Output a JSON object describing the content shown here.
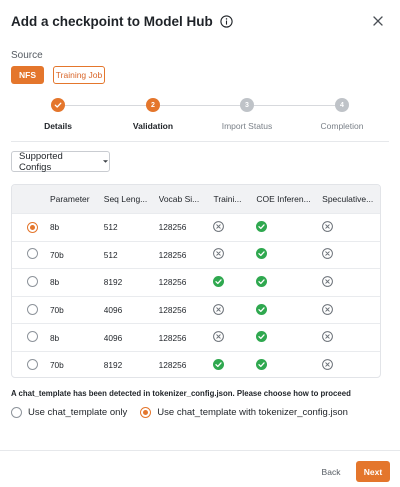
{
  "dialog": {
    "title": "Add a checkpoint to Model Hub",
    "info_icon": "info-icon",
    "close_icon": "close-icon"
  },
  "source": {
    "label": "Source",
    "options": [
      "NFS",
      "Training Job"
    ],
    "selected": "NFS"
  },
  "stepper": {
    "steps": [
      {
        "number": "1",
        "label": "Details",
        "state": "done"
      },
      {
        "number": "2",
        "label": "Validation",
        "state": "active"
      },
      {
        "number": "3",
        "label": "Import Status",
        "state": "todo"
      },
      {
        "number": "4",
        "label": "Completion",
        "state": "todo"
      }
    ]
  },
  "configs": {
    "dropdown_label": "Supported Configs",
    "columns": [
      "Parameter",
      "Seq Leng...",
      "Vocab Si...",
      "Traini...",
      "COE Inferen...",
      "Speculative..."
    ],
    "rows": [
      {
        "selected": true,
        "parameter": "8b",
        "seq_length": "512",
        "vocab_size": "128256",
        "training": "no",
        "coe_inference": "yes",
        "speculative": "no"
      },
      {
        "selected": false,
        "parameter": "70b",
        "seq_length": "512",
        "vocab_size": "128256",
        "training": "no",
        "coe_inference": "yes",
        "speculative": "no"
      },
      {
        "selected": false,
        "parameter": "8b",
        "seq_length": "8192",
        "vocab_size": "128256",
        "training": "yes",
        "coe_inference": "yes",
        "speculative": "no"
      },
      {
        "selected": false,
        "parameter": "70b",
        "seq_length": "4096",
        "vocab_size": "128256",
        "training": "no",
        "coe_inference": "yes",
        "speculative": "no"
      },
      {
        "selected": false,
        "parameter": "8b",
        "seq_length": "4096",
        "vocab_size": "128256",
        "training": "no",
        "coe_inference": "yes",
        "speculative": "no"
      },
      {
        "selected": false,
        "parameter": "70b",
        "seq_length": "8192",
        "vocab_size": "128256",
        "training": "yes",
        "coe_inference": "yes",
        "speculative": "no"
      }
    ]
  },
  "chat_template": {
    "notice": "A chat_template has been detected in tokenizer_config.json. Please choose how to proceed",
    "options": [
      "Use chat_template only",
      "Use chat_template with tokenizer_config.json"
    ],
    "selected_index": 1
  },
  "footer": {
    "back_label": "Back",
    "next_label": "Next"
  },
  "colors": {
    "accent": "#e4762c",
    "success": "#2fa84f",
    "neutral_icon": "#6b7178"
  }
}
